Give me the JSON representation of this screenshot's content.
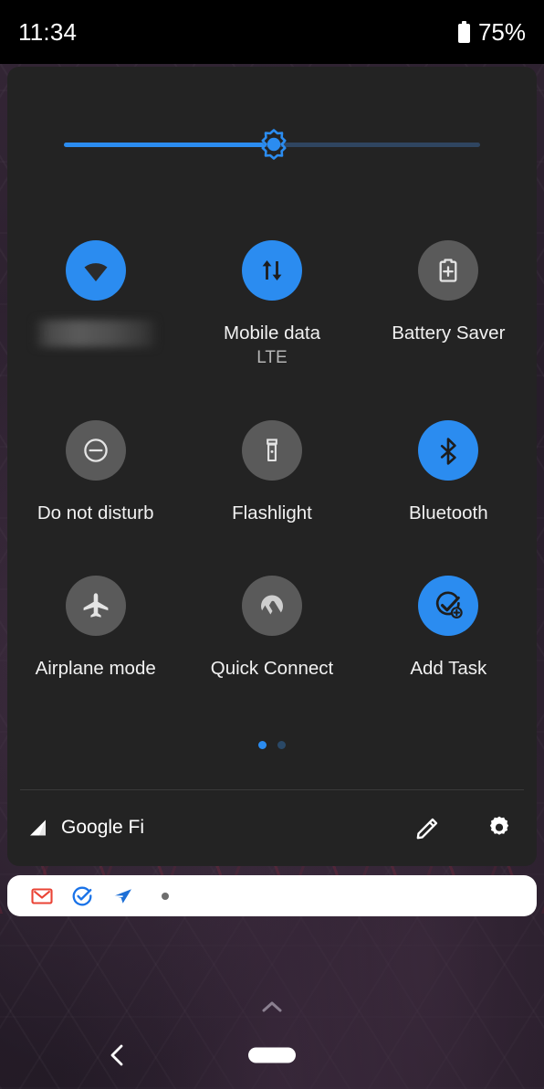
{
  "status_bar": {
    "clock": "11:34",
    "battery_percent": "75%",
    "battery_icon": "battery-icon"
  },
  "brightness": {
    "name": "brightness-slider",
    "value_percent": 48,
    "thumb_icon": "brightness-sun-icon",
    "fill_color": "#2b8cf0",
    "track_color": "#2f4560"
  },
  "tiles": [
    {
      "id": "wifi",
      "label": "",
      "label_redacted": true,
      "sub": "",
      "icon": "wifi-icon",
      "active": true
    },
    {
      "id": "mobile-data",
      "label": "Mobile data",
      "label_redacted": false,
      "sub": "LTE",
      "icon": "mobile-data-icon",
      "active": true
    },
    {
      "id": "battery-saver",
      "label": "Battery Saver",
      "label_redacted": false,
      "sub": "",
      "icon": "battery-plus-icon",
      "active": false
    },
    {
      "id": "do-not-disturb",
      "label": "Do not disturb",
      "label_redacted": false,
      "sub": "",
      "icon": "do-not-disturb-icon",
      "active": false
    },
    {
      "id": "flashlight",
      "label": "Flashlight",
      "label_redacted": false,
      "sub": "",
      "icon": "flashlight-icon",
      "active": false
    },
    {
      "id": "bluetooth",
      "label": "Bluetooth",
      "label_redacted": false,
      "sub": "",
      "icon": "bluetooth-icon",
      "active": true
    },
    {
      "id": "airplane-mode",
      "label": "Airplane mode",
      "label_redacted": false,
      "sub": "",
      "icon": "airplane-icon",
      "active": false
    },
    {
      "id": "quick-connect",
      "label": "Quick Connect",
      "label_redacted": false,
      "sub": "",
      "icon": "vpn-mountain-icon",
      "active": false
    },
    {
      "id": "add-task",
      "label": "Add Task",
      "label_redacted": false,
      "sub": "",
      "icon": "add-task-check-icon",
      "active": true
    }
  ],
  "pager": {
    "pages": 2,
    "active_index": 0
  },
  "footer": {
    "carrier": "Google Fi",
    "signal_icon": "signal-bars-icon",
    "edit_icon": "pencil-edit-icon",
    "settings_icon": "gear-settings-icon"
  },
  "notification_shelf": {
    "icons": [
      {
        "id": "gmail",
        "name": "gmail-icon"
      },
      {
        "id": "tasks",
        "name": "tasks-check-icon"
      },
      {
        "id": "telegram",
        "name": "telegram-send-icon"
      }
    ],
    "more_indicator": "more-notifications-dot"
  },
  "nav_bar": {
    "back_icon": "back-chevron-icon",
    "home_pill": "home-pill-indicator",
    "expand_icon": "chevron-up-icon"
  },
  "colors": {
    "accent_blue": "#2b8cf0",
    "panel_bg": "#232323",
    "tile_off_bg": "#5a5a5a",
    "status_bg": "#000000",
    "shelf_bg": "#ffffff"
  }
}
